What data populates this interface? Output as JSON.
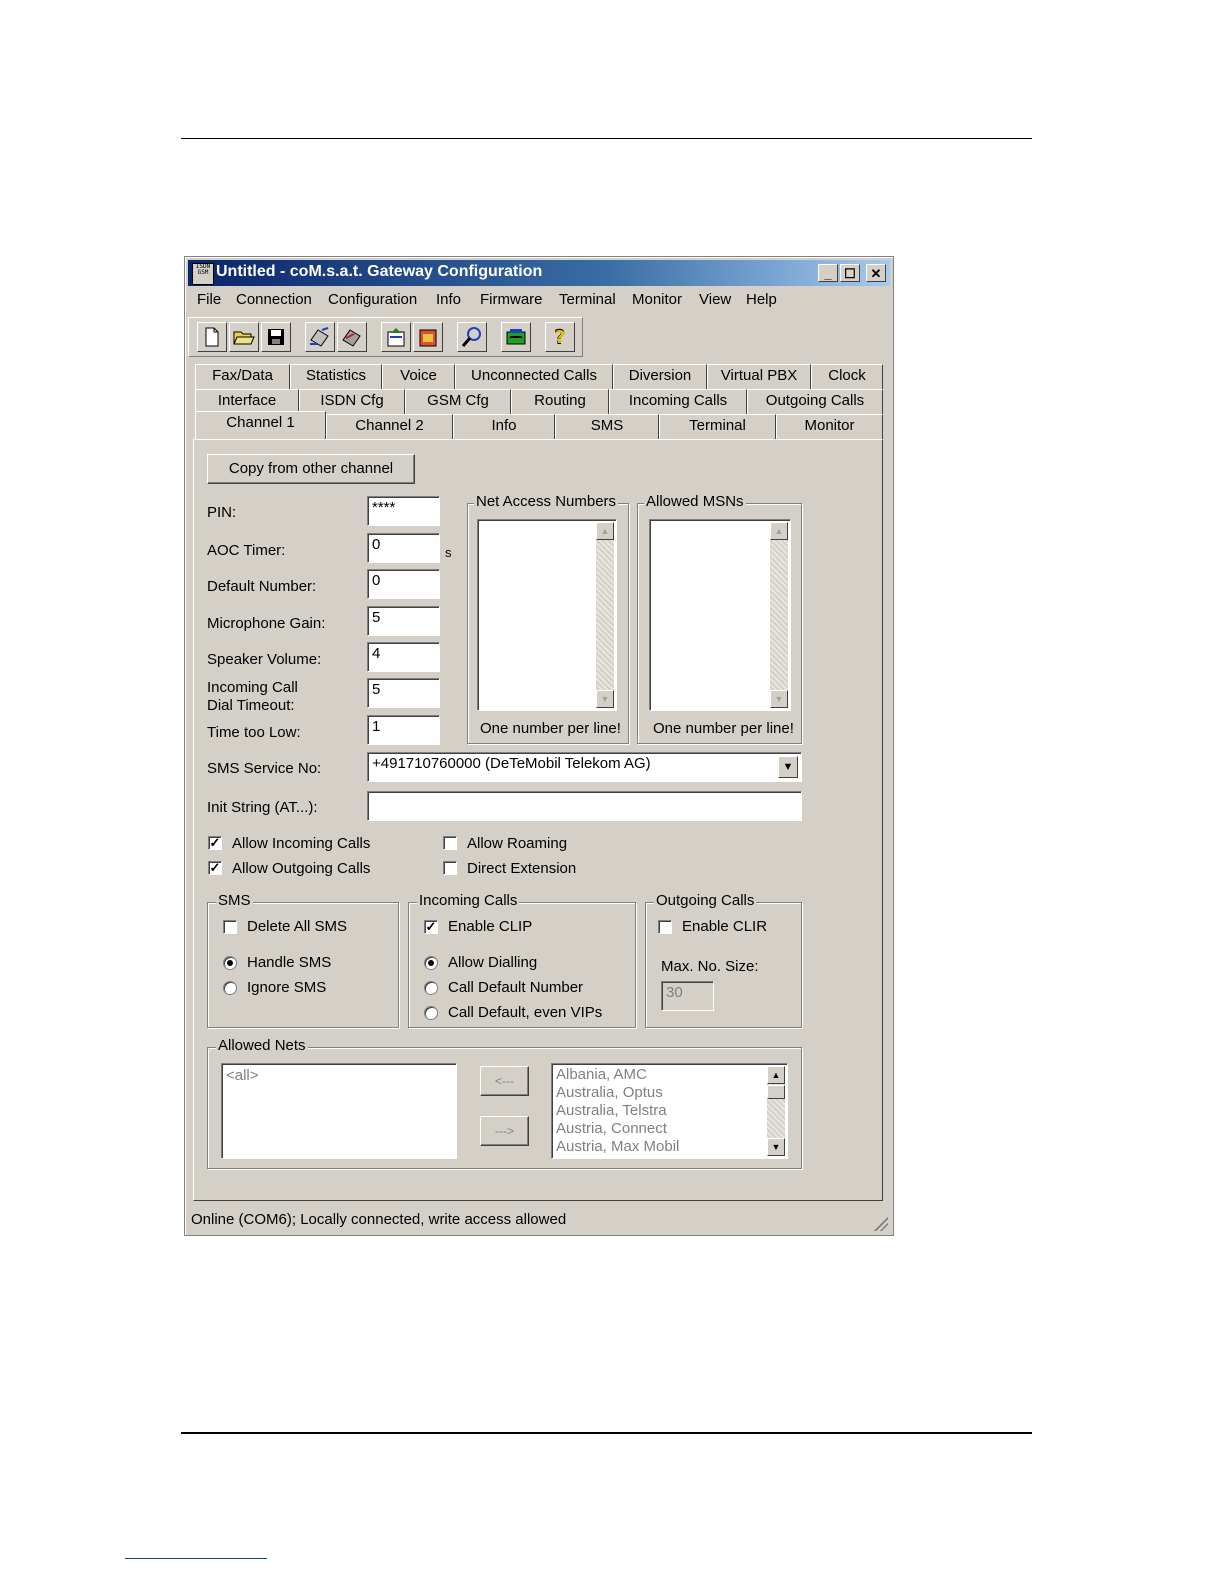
{
  "window": {
    "app_icon_text": "ISDN GSM",
    "title": "Untitled - coM.s.a.t. Gateway Configuration",
    "min": "_",
    "max": "☐",
    "close": "✕"
  },
  "menu": [
    "File",
    "Connection",
    "Configuration",
    "Info",
    "Firmware",
    "Terminal",
    "Monitor",
    "View",
    "Help"
  ],
  "toolbar": {
    "icons": [
      "new-file-icon",
      "open-folder-icon",
      "save-disk-icon",
      "read-config-icon",
      "write-config-icon",
      "upload-icon",
      "download-icon",
      "search-icon",
      "sim-card-icon",
      "help-icon"
    ]
  },
  "tabs": {
    "row1": [
      "Fax/Data",
      "Statistics",
      "Voice",
      "Unconnected Calls",
      "Diversion",
      "Virtual PBX",
      "Clock"
    ],
    "row2": [
      "Interface",
      "ISDN Cfg",
      "GSM Cfg",
      "Routing",
      "Incoming Calls",
      "Outgoing Calls"
    ],
    "row3": [
      "Channel 1",
      "Channel 2",
      "Info",
      "SMS",
      "Terminal",
      "Monitor"
    ],
    "active": "Channel 1"
  },
  "channel": {
    "copy_button": "Copy from other channel",
    "pin_label": "PIN:",
    "pin_value": "****",
    "aoc_label": "AOC Timer:",
    "aoc_value": "0",
    "aoc_unit": "s",
    "default_number_label": "Default Number:",
    "default_number_value": "0",
    "mic_gain_label": "Microphone Gain:",
    "mic_gain_value": "5",
    "speaker_label": "Speaker Volume:",
    "speaker_value": "4",
    "incoming_timeout_label_1": "Incoming Call",
    "incoming_timeout_label_2": "Dial Timeout:",
    "incoming_timeout_value": "5",
    "time_low_label": "Time too Low:",
    "time_low_value": "1",
    "net_access_title": "Net Access Numbers",
    "net_access_hint": "One number per line!",
    "allowed_msns_title": "Allowed MSNs",
    "allowed_msns_hint": "One number per line!",
    "sms_service_label": "SMS Service No:",
    "sms_service_value": "+491710760000 (DeTeMobil Telekom AG)",
    "init_string_label": "Init String (AT...):",
    "init_string_value": "",
    "allow_incoming": "Allow Incoming Calls",
    "allow_outgoing": "Allow Outgoing Calls",
    "allow_roaming": "Allow Roaming",
    "direct_extension": "Direct Extension",
    "check_mark": "✓"
  },
  "sms_group": {
    "title": "SMS",
    "delete_all": "Delete All SMS",
    "handle": "Handle SMS",
    "ignore": "Ignore SMS"
  },
  "incoming_group": {
    "title": "Incoming Calls",
    "enable_clip": "Enable CLIP",
    "allow_dialling": "Allow Dialling",
    "call_default": "Call Default Number",
    "call_default_vips": "Call Default, even VIPs"
  },
  "outgoing_group": {
    "title": "Outgoing Calls",
    "enable_clir": "Enable CLIR",
    "max_size_label": "Max. No. Size:",
    "max_size_value": "30"
  },
  "allowed_nets": {
    "title": "Allowed Nets",
    "selected": [
      "<all>"
    ],
    "add_left": "<---",
    "add_right": "--->",
    "available": [
      "Albania, AMC",
      "Australia, Optus",
      "Australia, Telstra",
      "Austria, Connect",
      "Austria, Max Mobil"
    ]
  },
  "status": "Online (COM6); Locally connected, write access allowed"
}
